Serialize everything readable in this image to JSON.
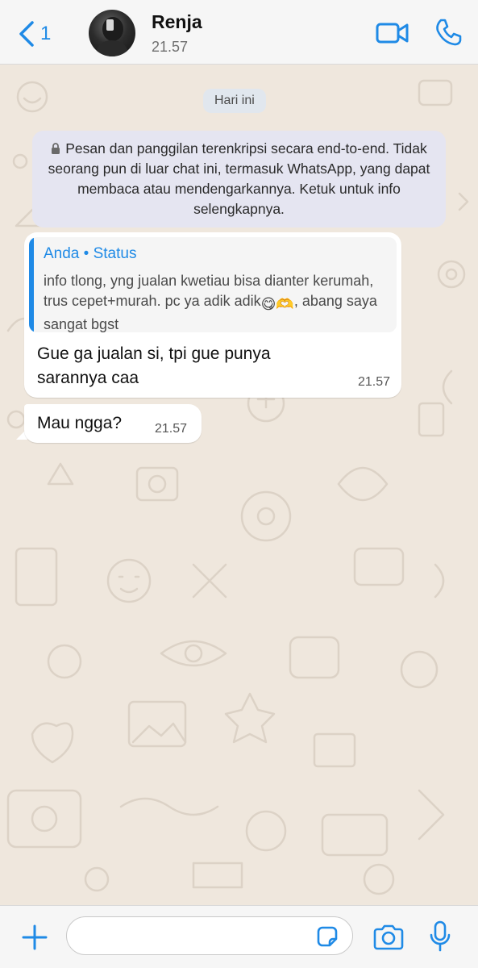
{
  "header": {
    "back_count": "1",
    "contact_name": "Renja",
    "last_seen": "21.57",
    "icons": [
      "chevron-left-icon",
      "video-camera-icon",
      "phone-icon"
    ]
  },
  "chat": {
    "date_divider": "Hari ini",
    "encryption_notice": "Pesan dan panggilan terenkripsi secara end-to-end. Tidak seorang pun di luar chat ini, termasuk WhatsApp, yang dapat membaca atau mendengarkannya. Ketuk untuk info selengkapnya.",
    "messages": [
      {
        "quote_sender": "Anda • Status",
        "quote_text": "info tlong, yng jualan kwetiau bisa dianter kerumah, trus cepet+murah. pc ya adik adik",
        "quote_text_suffix": ", abang saya sangat bgst",
        "quote_emojis": [
          "😋",
          "🫶"
        ],
        "text": "Gue ga jualan si, tpi gue punya sarannya caa",
        "time": "21.57"
      },
      {
        "text": "Mau ngga?",
        "time": "21.57"
      }
    ]
  },
  "input_bar": {
    "placeholder": "",
    "icons": [
      "plus-icon",
      "sticker-icon",
      "camera-icon",
      "microphone-icon"
    ]
  },
  "colors": {
    "accent": "#1f8ae6",
    "chat_background": "#efe7dd",
    "bubble": "#ffffff",
    "notice_background": "#e5e5f1"
  }
}
